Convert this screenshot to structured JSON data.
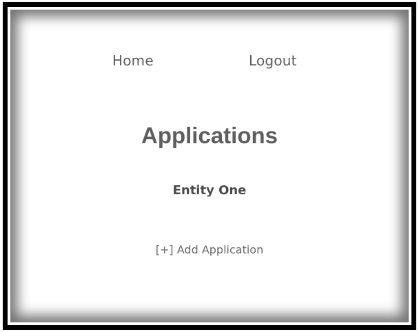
{
  "nav": {
    "home_label": "Home",
    "logout_label": "Logout"
  },
  "main": {
    "title": "Applications",
    "entity_name": "Entity One",
    "add_application_label": "[+] Add Application"
  },
  "colors": {
    "frame": "#000000",
    "background": "#ffffff",
    "text": "#5e5e5e"
  }
}
